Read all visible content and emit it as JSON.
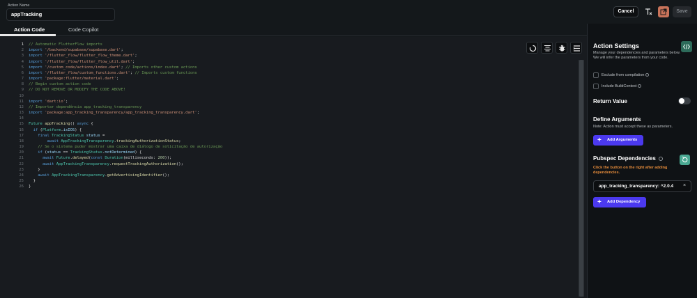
{
  "header": {
    "action_name_label": "Action Name",
    "action_name_value": "appTracking",
    "cancel_label": "Cancel",
    "save_label": "Save",
    "icon_clear": "clear-format-icon",
    "icon_open": "open-external-icon"
  },
  "tabs": [
    {
      "label": "Action Code",
      "active": true
    },
    {
      "label": "Code Copilot",
      "active": false
    }
  ],
  "editor": {
    "line_numbers": [
      "1",
      "2",
      "3",
      "4",
      "5",
      "6",
      "7",
      "8",
      "9",
      "10",
      "11",
      "12",
      "13",
      "14",
      "15",
      "16",
      "17",
      "18",
      "19",
      "20",
      "21",
      "22",
      "23",
      "24",
      "25",
      "26"
    ],
    "toolbar_icons": [
      "loading-icon",
      "format-icon",
      "bug-icon",
      "list-icon"
    ]
  },
  "right_panel": {
    "title": "Action Settings",
    "description": "Manage your dependencies and parameters below.\nWe will infer the parameters from your code.",
    "exclude_label": "Exclude from compilation",
    "build_context_label": "Include BuildContext",
    "return_value_label": "Return Value",
    "return_value_enabled": false,
    "define_args_title": "Define Arguments",
    "define_args_note": "Note: Action must accept these as parameters.",
    "add_args_label": "Add Arguments",
    "pubspec_title": "Pubspec Dependencies",
    "pubspec_note": "Click the button on the right after adding dependencies.",
    "dependency": "app_tracking_transparency: ^2.0.4",
    "dependency_remove": "×",
    "add_dependency_label": "Add Dependency"
  },
  "colors": {
    "primary": "#4b39ef",
    "warning_text": "#e58b3a",
    "accent_green": "#4aa892",
    "open_button": "#c8735a"
  }
}
